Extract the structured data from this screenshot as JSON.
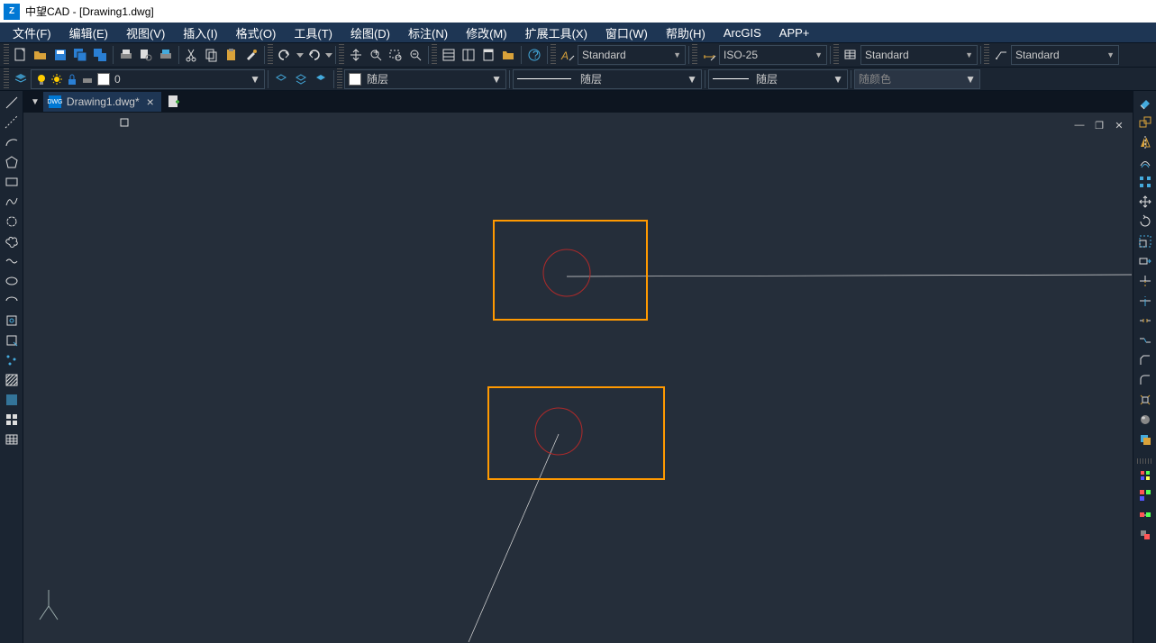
{
  "title": "中望CAD - [Drawing1.dwg]",
  "menu": [
    "文件(F)",
    "编辑(E)",
    "视图(V)",
    "插入(I)",
    "格式(O)",
    "工具(T)",
    "绘图(D)",
    "标注(N)",
    "修改(M)",
    "扩展工具(X)",
    "窗口(W)",
    "帮助(H)",
    "ArcGIS",
    "APP+"
  ],
  "styles": {
    "text_style": "Standard",
    "dim_style": "ISO-25",
    "table_style": "Standard",
    "mleader_style": "Standard"
  },
  "layer": {
    "current": "0",
    "bylayer1": "随层",
    "bylayer2": "随层",
    "bylayer3": "随层",
    "bycolor": "随颜色"
  },
  "tab": {
    "name": "Drawing1.dwg*"
  }
}
